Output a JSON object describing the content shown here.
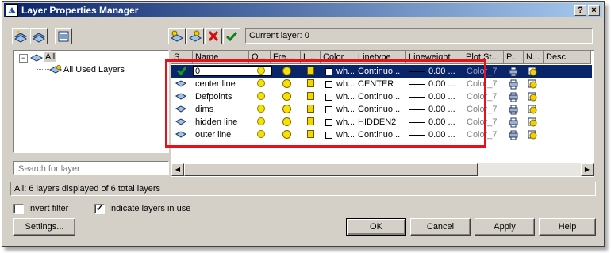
{
  "window": {
    "title": "Layer Properties Manager",
    "help_btn": "?",
    "close_btn": "×"
  },
  "current_layer": "Current layer: 0",
  "tree": {
    "root": "All",
    "child": "All Used Layers"
  },
  "search": {
    "placeholder": "Search for layer"
  },
  "columns": [
    "S..",
    "Name",
    "O...",
    "Fre...",
    "L...",
    "Color",
    "Linetype",
    "Lineweight",
    "Plot St...",
    "P...",
    "N...",
    "Desc"
  ],
  "layers": [
    {
      "name": "0",
      "color": "wh...",
      "linetype": "Continuo...",
      "lineweight": "0.00 ...",
      "plot_style": "Color_7",
      "current": true,
      "selected": true
    },
    {
      "name": "center line",
      "color": "wh...",
      "linetype": "CENTER",
      "lineweight": "0.00 ...",
      "plot_style": "Color_7",
      "current": false,
      "selected": false
    },
    {
      "name": "Defpoints",
      "color": "wh...",
      "linetype": "Continuo...",
      "lineweight": "0.00 ...",
      "plot_style": "Color_7",
      "current": false,
      "selected": false
    },
    {
      "name": "dims",
      "color": "wh...",
      "linetype": "Continuo...",
      "lineweight": "0.00 ...",
      "plot_style": "Color_7",
      "current": false,
      "selected": false
    },
    {
      "name": "hidden line",
      "color": "wh...",
      "linetype": "HIDDEN2",
      "lineweight": "0.00 ...",
      "plot_style": "Color_7",
      "current": false,
      "selected": false
    },
    {
      "name": "outer line",
      "color": "wh...",
      "linetype": "Continuo...",
      "lineweight": "0.00 ...",
      "plot_style": "Color_7",
      "current": false,
      "selected": false
    }
  ],
  "status": "All: 6 layers displayed of 6 total layers",
  "options": {
    "invert_filter": "Invert filter",
    "invert_checked": false,
    "indicate_used": "Indicate layers in use",
    "indicate_checked": true
  },
  "buttons": {
    "settings": "Settings...",
    "ok": "OK",
    "cancel": "Cancel",
    "apply": "Apply",
    "help": "Help"
  },
  "colors": {
    "highlight_box": "#e8101a",
    "selection": "#0a246a",
    "title_start": "#0a246a",
    "title_end": "#a6caf0"
  }
}
